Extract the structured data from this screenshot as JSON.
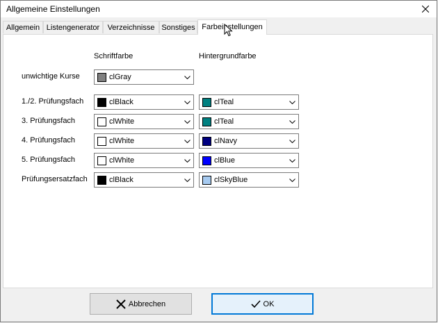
{
  "window": {
    "title": "Allgemeine Einstellungen"
  },
  "tabs": [
    {
      "label": "Allgemein"
    },
    {
      "label": "Listengenerator"
    },
    {
      "label": "Verzeichnisse"
    },
    {
      "label": "Sonstiges"
    },
    {
      "label": "Farbeinstellungen"
    }
  ],
  "active_tab": "Farbeinstellungen",
  "columns": {
    "font": "Schriftfarbe",
    "background": "Hintergrundfarbe"
  },
  "rows": [
    {
      "label": "unwichtige Kurse",
      "font": {
        "name": "clGray",
        "color": "#808080"
      }
    },
    {
      "label": "1./2. Prüfungsfach",
      "font": {
        "name": "clBlack",
        "color": "#000000"
      },
      "bg": {
        "name": "clTeal",
        "color": "#008080"
      }
    },
    {
      "label": "3. Prüfungsfach",
      "font": {
        "name": "clWhite",
        "color": "#ffffff"
      },
      "bg": {
        "name": "clTeal",
        "color": "#008080"
      }
    },
    {
      "label": "4. Prüfungsfach",
      "font": {
        "name": "clWhite",
        "color": "#ffffff"
      },
      "bg": {
        "name": "clNavy",
        "color": "#000080"
      }
    },
    {
      "label": "5. Prüfungsfach",
      "font": {
        "name": "clWhite",
        "color": "#ffffff"
      },
      "bg": {
        "name": "clBlue",
        "color": "#0000ff"
      }
    },
    {
      "label": "Prüfungsersatzfach",
      "font": {
        "name": "clBlack",
        "color": "#000000"
      },
      "bg": {
        "name": "clSkyBlue",
        "color": "#a6caf0"
      }
    }
  ],
  "buttons": {
    "cancel": {
      "label": "Abbrechen",
      "icon": "x-icon"
    },
    "ok": {
      "label": "OK",
      "icon": "checkmark-icon"
    }
  }
}
